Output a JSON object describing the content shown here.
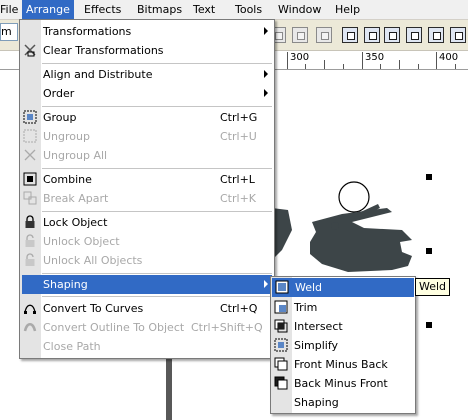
{
  "menubar": {
    "items": [
      "File",
      "Arrange",
      "Effects",
      "Bitmaps",
      "Text",
      "Tools",
      "Window",
      "Help"
    ]
  },
  "toolbar": {
    "left_combo_text": "m"
  },
  "ruler": {
    "labels": [
      "300",
      "350",
      "400"
    ]
  },
  "arrange_menu": {
    "transformations": "Transformations",
    "clear_transformations": "Clear Transformations",
    "align_distribute": "Align and Distribute",
    "order": "Order",
    "group": "Group",
    "group_shortcut": "Ctrl+G",
    "ungroup": "Ungroup",
    "ungroup_shortcut": "Ctrl+U",
    "ungroup_all": "Ungroup All",
    "combine": "Combine",
    "combine_shortcut": "Ctrl+L",
    "break_apart": "Break  Apart",
    "break_apart_shortcut": "Ctrl+K",
    "lock_object": "Lock Object",
    "unlock_object": "Unlock Object",
    "unlock_all_objects": "Unlock All Objects",
    "shaping": "Shaping",
    "convert_to_curves": "Convert To Curves",
    "convert_to_curves_shortcut": "Ctrl+Q",
    "convert_outline": "Convert Outline To Object",
    "convert_outline_shortcut": "Ctrl+Shift+Q",
    "close_path": "Close Path"
  },
  "shaping_menu": {
    "weld": "Weld",
    "trim": "Trim",
    "intersect": "Intersect",
    "simplify": "Simplify",
    "front_minus_back": "Front Minus Back",
    "back_minus_front": "Back Minus Front",
    "shaping": "Shaping"
  },
  "tooltip": {
    "text": "Weld"
  },
  "colors": {
    "highlight": "#316ac5",
    "tank": "#3d4548"
  }
}
